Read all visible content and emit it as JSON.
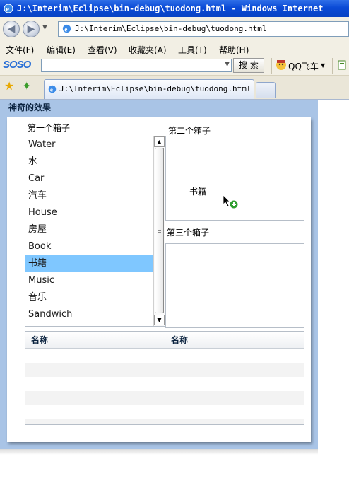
{
  "window": {
    "title": "J:\\Interim\\Eclipse\\bin-debug\\tuodong.html - Windows Internet"
  },
  "address": {
    "url": "J:\\Interim\\Eclipse\\bin-debug\\tuodong.html"
  },
  "menu": [
    "文件(F)",
    "编辑(E)",
    "查看(V)",
    "收藏夹(A)",
    "工具(T)",
    "帮助(H)"
  ],
  "toolbar": {
    "soso_logo": "SOSO",
    "search_button": "搜 索",
    "qq_label": "QQ飞车"
  },
  "tab": {
    "label": "J:\\Interim\\Eclipse\\bin-debug\\tuodong.html"
  },
  "panel": {
    "title": "神奇的效果"
  },
  "box1": {
    "label": "第一个箱子",
    "items": [
      "Water",
      "水",
      "Car",
      "汽车",
      "House",
      "房屋",
      "Book",
      "书籍",
      "Music",
      "音乐",
      "Sandwich"
    ],
    "selected_index": 7
  },
  "box2": {
    "label": "第二个箱子",
    "drag_text": "书籍"
  },
  "box3": {
    "label": "第三个箱子"
  },
  "grid": {
    "columns": [
      "名称",
      "名称"
    ]
  },
  "colors": {
    "selection": "#7fc7ff",
    "panel_border": "#a9c4e6",
    "titlebar": "#0a4ad6"
  }
}
